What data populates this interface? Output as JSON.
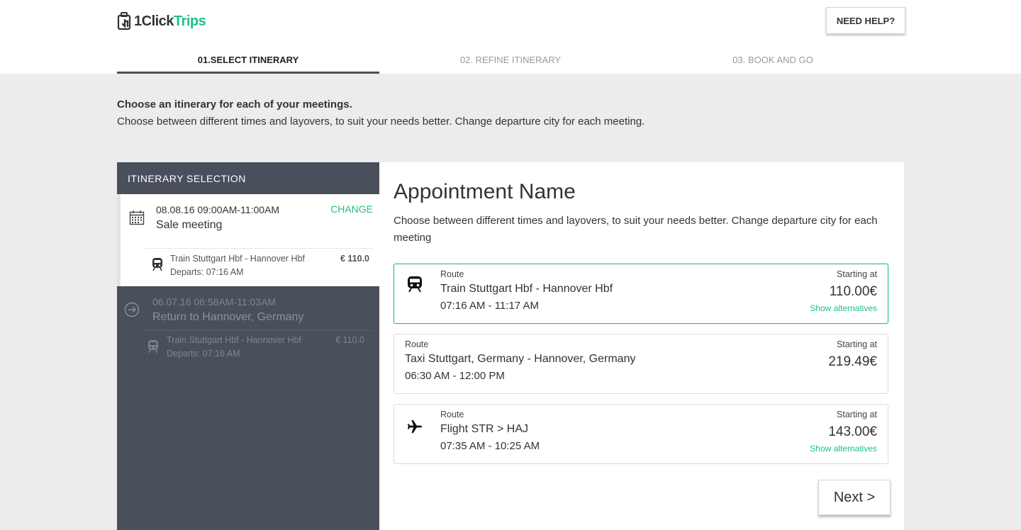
{
  "brand": {
    "logo_part1": "1Click",
    "logo_part2": "Trips",
    "accent": "#1dbf8a",
    "sidebar_bg": "#4a4f5c"
  },
  "header": {
    "help_label": "NEED HELP?"
  },
  "steps": [
    {
      "label": "01.SELECT ITINERARY",
      "active": true
    },
    {
      "label": "02. REFINE ITINERARY",
      "active": false
    },
    {
      "label": "03. BOOK AND GO",
      "active": false
    }
  ],
  "intro": {
    "title": "Choose an itinerary for each of your meetings.",
    "text": "Choose between different times and layovers, to suit your needs better. Change departure city for each meeting."
  },
  "sidebar": {
    "title": "ITINERARY SELECTION",
    "meetings": [
      {
        "datetime": "08.08.16 09:00AM-11:00AM",
        "name": "Sale meeting",
        "change_label": "CHANGE",
        "icon": "calendar-icon",
        "leg": {
          "icon": "train-icon",
          "route": "Train Stuttgart Hbf - Hannover Hbf",
          "departs": "Departs: 07:16 AM",
          "price": "€ 110.0"
        }
      },
      {
        "datetime": "06.07.16 06:58AM-11:03AM",
        "name": "Return to Hannover, Germany",
        "icon": "arrow-circle-icon",
        "leg": {
          "icon": "train-icon",
          "route": "Train Stuttgart Hbf - Hannover Hbf",
          "departs": "Departs: 07:16 AM",
          "price": "€ 110.0"
        }
      }
    ]
  },
  "main": {
    "title": "Appointment Name",
    "description": "Choose between different times and layovers, to suit your needs better. Change departure city for each meeting",
    "routes": [
      {
        "kicker": "Route",
        "icon": "train-icon",
        "name": "Train Stuttgart Hbf - Hannover Hbf",
        "time": "07:16 AM - 11:17 AM",
        "starting_label": "Starting at",
        "price": "110.00€",
        "alternatives_label": "Show alternatives",
        "selected": true
      },
      {
        "kicker": "Route",
        "icon": "",
        "name": "Taxi Stuttgart, Germany - Hannover, Germany",
        "time": "06:30 AM - 12:00 PM",
        "starting_label": "Starting at",
        "price": "219.49€",
        "alternatives_label": "",
        "selected": false
      },
      {
        "kicker": "Route",
        "icon": "plane-icon",
        "name": "Flight STR > HAJ",
        "time": "07:35 AM - 10:25 AM",
        "starting_label": "Starting at",
        "price": "143.00€",
        "alternatives_label": "Show alternatives",
        "selected": false
      }
    ],
    "next_label": "Next >"
  }
}
